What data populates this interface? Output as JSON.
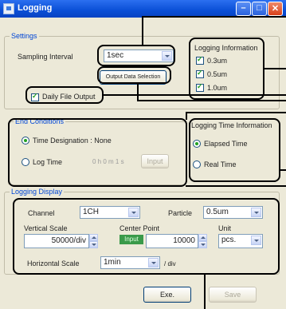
{
  "window": {
    "title": "Logging",
    "buttons": {
      "minimize": "–",
      "maximize": "□",
      "close": "✕"
    }
  },
  "settings": {
    "legend": "Settings",
    "sampling_label": "Sampling Interval",
    "sampling_value": "1sec",
    "output_button": "Output Data Selection",
    "daily_file_label": "Daily File Output",
    "daily_file_checked": true
  },
  "logging_info": {
    "legend": "Logging Information",
    "items": [
      {
        "label": "0.3um",
        "checked": true
      },
      {
        "label": "0.5um",
        "checked": true
      },
      {
        "label": "1.0um",
        "checked": true
      }
    ]
  },
  "end_conditions": {
    "legend": "End Conditions",
    "time_designation": "Time Designation : None",
    "log_time": "Log Time",
    "log_time_value": "0 h 0 m 1 s",
    "input_button": "Input",
    "selected": "time_designation"
  },
  "logging_time_info": {
    "legend": "Logging Time Information",
    "elapsed": "Elapsed Time",
    "real": "Real Time",
    "selected": "elapsed"
  },
  "logging_display": {
    "legend": "Logging Display",
    "channel_label": "Channel",
    "channel_value": "1CH",
    "particle_label": "Particle",
    "particle_value": "0.5um",
    "vertical_scale_label": "Vertical Scale",
    "vertical_scale_value": "50000/div",
    "center_point_label": "Center Point",
    "center_input_label": "Input",
    "center_value": "10000",
    "unit_label": "Unit",
    "unit_value": "pcs.",
    "horizontal_scale_label": "Horizontal Scale",
    "horizontal_scale_value": "1min",
    "horizontal_suffix": "/ div"
  },
  "footer": {
    "exe": "Exe.",
    "save": "Save"
  },
  "colors": {
    "title_bar": "#0a4fd6",
    "group_legend": "#0046d5",
    "window_bg": "#ece9d8",
    "callout": "#000000"
  }
}
